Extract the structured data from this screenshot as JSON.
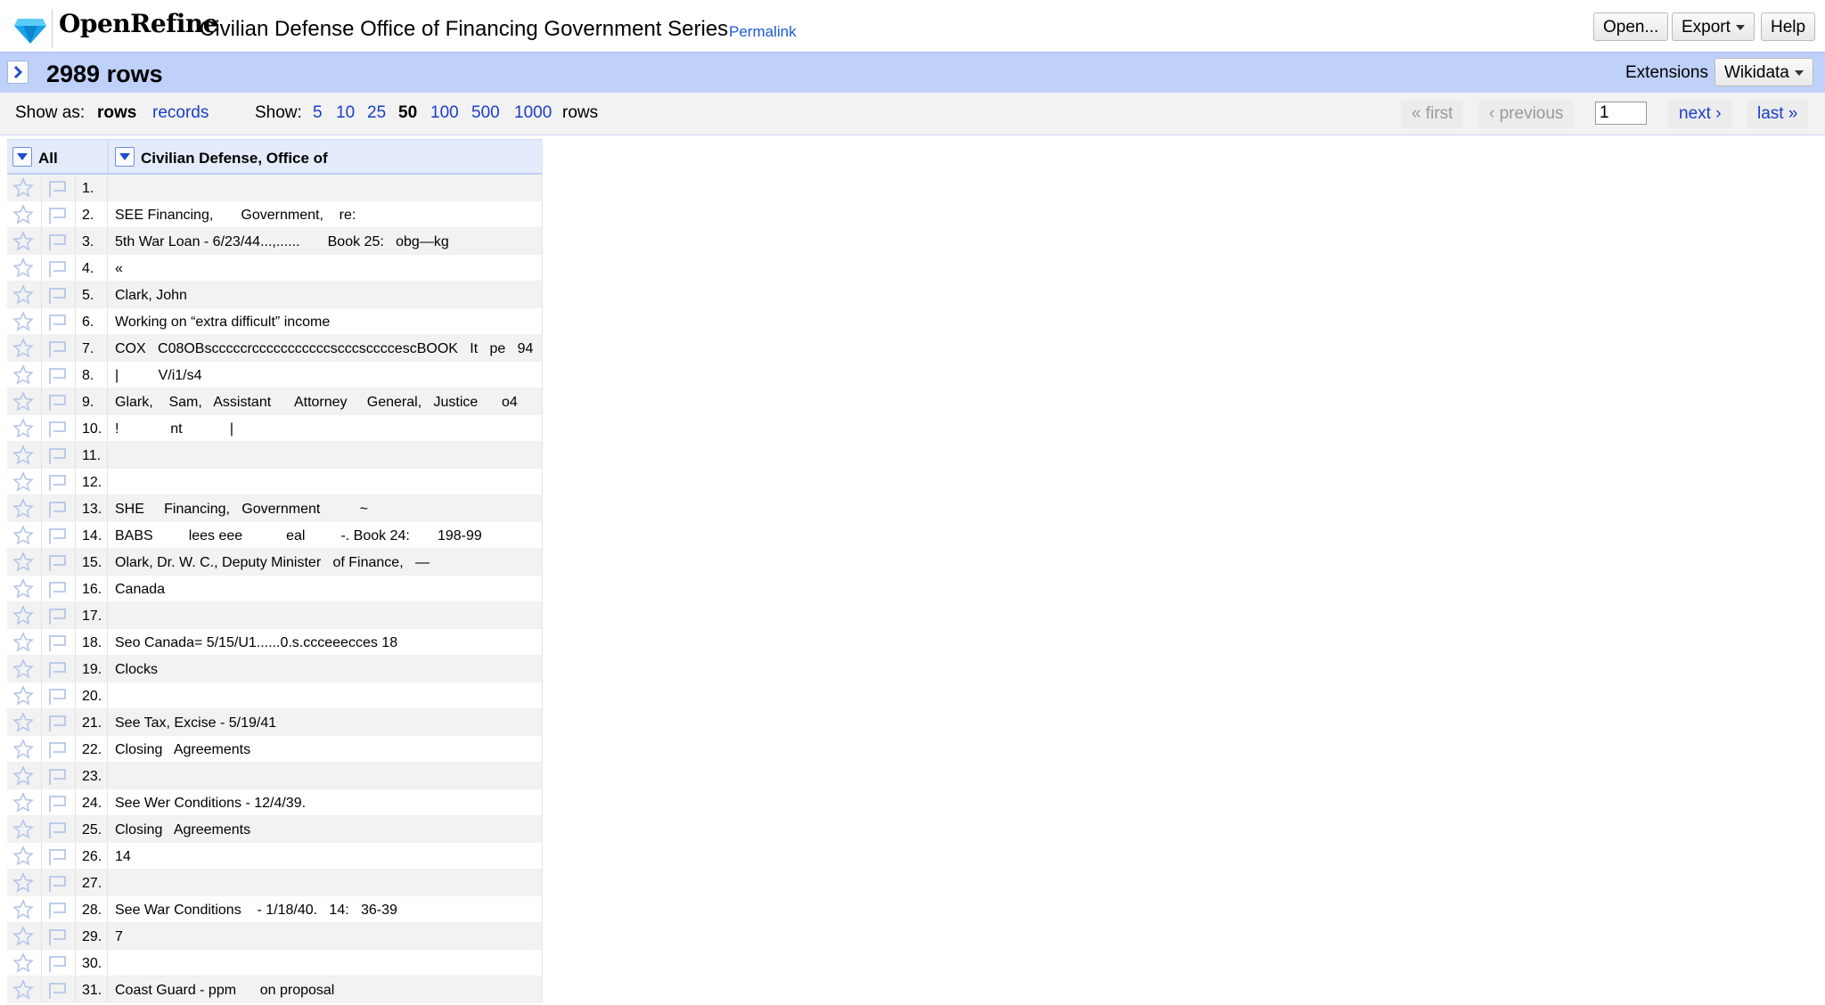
{
  "header": {
    "app_name": "OpenRefine",
    "project_name": "Civilian Defense Office of Financing Government Series",
    "permalink": "Permalink",
    "buttons": {
      "open": "Open...",
      "export": "Export",
      "help": "Help"
    }
  },
  "summary": {
    "row_count": "2989 rows",
    "extensions_label": "Extensions",
    "wikidata": "Wikidata"
  },
  "controls": {
    "show_as_label": "Show as:",
    "mode_rows": "rows",
    "mode_records": "records",
    "show_label": "Show:",
    "page_sizes": [
      "5",
      "10",
      "25",
      "50",
      "100",
      "500",
      "1000"
    ],
    "selected_page_size": "50",
    "rows_suffix": "rows",
    "pager": {
      "first": "« first",
      "previous": "‹ previous",
      "page": "1",
      "next": "next ›",
      "last": "last »"
    }
  },
  "grid": {
    "all_label": "All",
    "column_name": "Civilian Defense, Office of",
    "rows": [
      {
        "n": "1.",
        "v": ""
      },
      {
        "n": "2.",
        "v": "SEE Financing,       Government,    re:"
      },
      {
        "n": "3.",
        "v": "5th War Loan - 6/23/44...,......       Book 25:   obg—kg"
      },
      {
        "n": "4.",
        "v": "«"
      },
      {
        "n": "5.",
        "v": "Clark, John"
      },
      {
        "n": "6.",
        "v": "Working on “extra difficult” income"
      },
      {
        "n": "7.",
        "v": "COX   C08OBscccccrcccccccccccscccsccccescBOOK   It   pe   94"
      },
      {
        "n": "8.",
        "v": "|          V/i1/s4"
      },
      {
        "n": "9.",
        "v": "Glark,    Sam,   Assistant      Attorney     General,   Justice      o4"
      },
      {
        "n": "10.",
        "v": "!             nt            |"
      },
      {
        "n": "11.",
        "v": ""
      },
      {
        "n": "12.",
        "v": ""
      },
      {
        "n": "13.",
        "v": "SHE     Financing,   Government          ~"
      },
      {
        "n": "14.",
        "v": "BABS         lees eee           eal         -. Book 24:       198-99"
      },
      {
        "n": "15.",
        "v": "Olark, Dr. W. C., Deputy Minister   of Finance,   —"
      },
      {
        "n": "16.",
        "v": "Canada"
      },
      {
        "n": "17.",
        "v": ""
      },
      {
        "n": "18.",
        "v": "Seo Canada= 5/15/U1......0.s.ccceeecces 18"
      },
      {
        "n": "19.",
        "v": "Clocks"
      },
      {
        "n": "20.",
        "v": ""
      },
      {
        "n": "21.",
        "v": "See Tax, Excise - 5/19/41"
      },
      {
        "n": "22.",
        "v": "Closing   Agreements"
      },
      {
        "n": "23.",
        "v": ""
      },
      {
        "n": "24.",
        "v": "See Wer Conditions - 12/4/39."
      },
      {
        "n": "25.",
        "v": "Closing   Agreements"
      },
      {
        "n": "26.",
        "v": "14"
      },
      {
        "n": "27.",
        "v": ""
      },
      {
        "n": "28.",
        "v": "See War Conditions    - 1/18/40.   14:   36-39"
      },
      {
        "n": "29.",
        "v": "7"
      },
      {
        "n": "30.",
        "v": ""
      },
      {
        "n": "31.",
        "v": "Coast Guard - ppm      on proposal"
      }
    ]
  }
}
